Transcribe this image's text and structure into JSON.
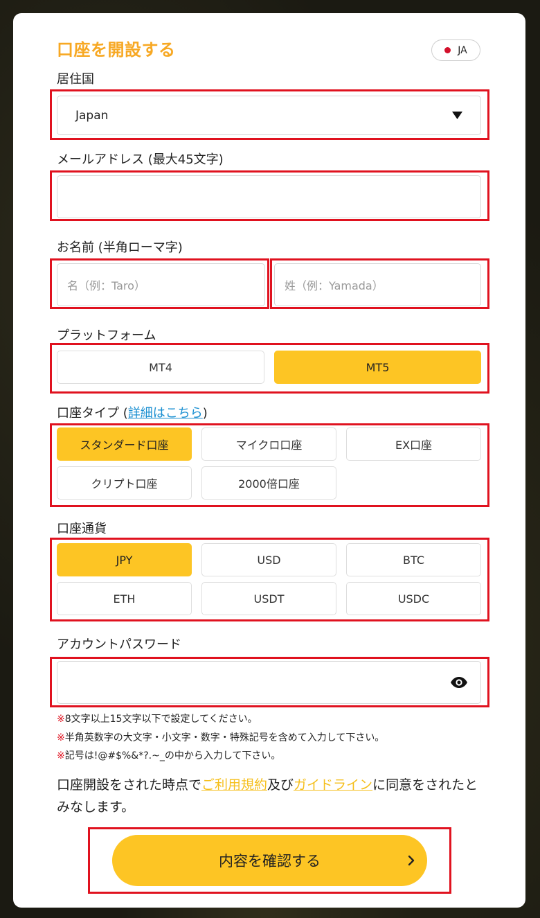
{
  "header": {
    "title": "口座を開設する",
    "language": "JA"
  },
  "country": {
    "label": "居住国",
    "value": "Japan"
  },
  "email": {
    "label": "メールアドレス (最大45文字)",
    "value": ""
  },
  "name": {
    "label": "お名前 (半角ローマ字)",
    "first_placeholder": "名（例：Taro）",
    "last_placeholder": "姓（例：Yamada）"
  },
  "platform": {
    "label": "プラットフォーム",
    "options": [
      "MT4",
      "MT5"
    ],
    "selected": "MT5"
  },
  "account_type": {
    "label_prefix": "口座タイプ (",
    "link_text": "詳細はこちら",
    "label_suffix": ")",
    "options": [
      "スタンダード口座",
      "マイクロ口座",
      "EX口座",
      "クリプト口座",
      "2000倍口座"
    ],
    "selected": "スタンダード口座"
  },
  "currency": {
    "label": "口座通貨",
    "options": [
      "JPY",
      "USD",
      "BTC",
      "ETH",
      "USDT",
      "USDC"
    ],
    "selected": "JPY"
  },
  "password": {
    "label": "アカウントパスワード",
    "value": "",
    "icon": "eye-icon",
    "notes": [
      {
        "mark": "※",
        "text": "8文字以上15文字以下で設定してください。"
      },
      {
        "mark": "※",
        "text": "半角英数字の大文字・小文字・数字・特殊記号を含めて入力して下さい。"
      },
      {
        "mark": "※",
        "text": "記号は!@#$%&*?.~_の中から入力して下さい。"
      }
    ]
  },
  "agreement": {
    "text1": "口座開設をされた時点で",
    "terms_link": "ご利用規約",
    "text2": "及び",
    "guideline_link": "ガイドライン",
    "text3": "に同意をされたとみなします。"
  },
  "submit": {
    "label": "内容を確認する",
    "icon": "chevron-right-icon"
  },
  "colors": {
    "accent": "#fdc524",
    "title": "#f7a823",
    "highlight_box": "#e0121f",
    "link": "#1a8fd1"
  }
}
